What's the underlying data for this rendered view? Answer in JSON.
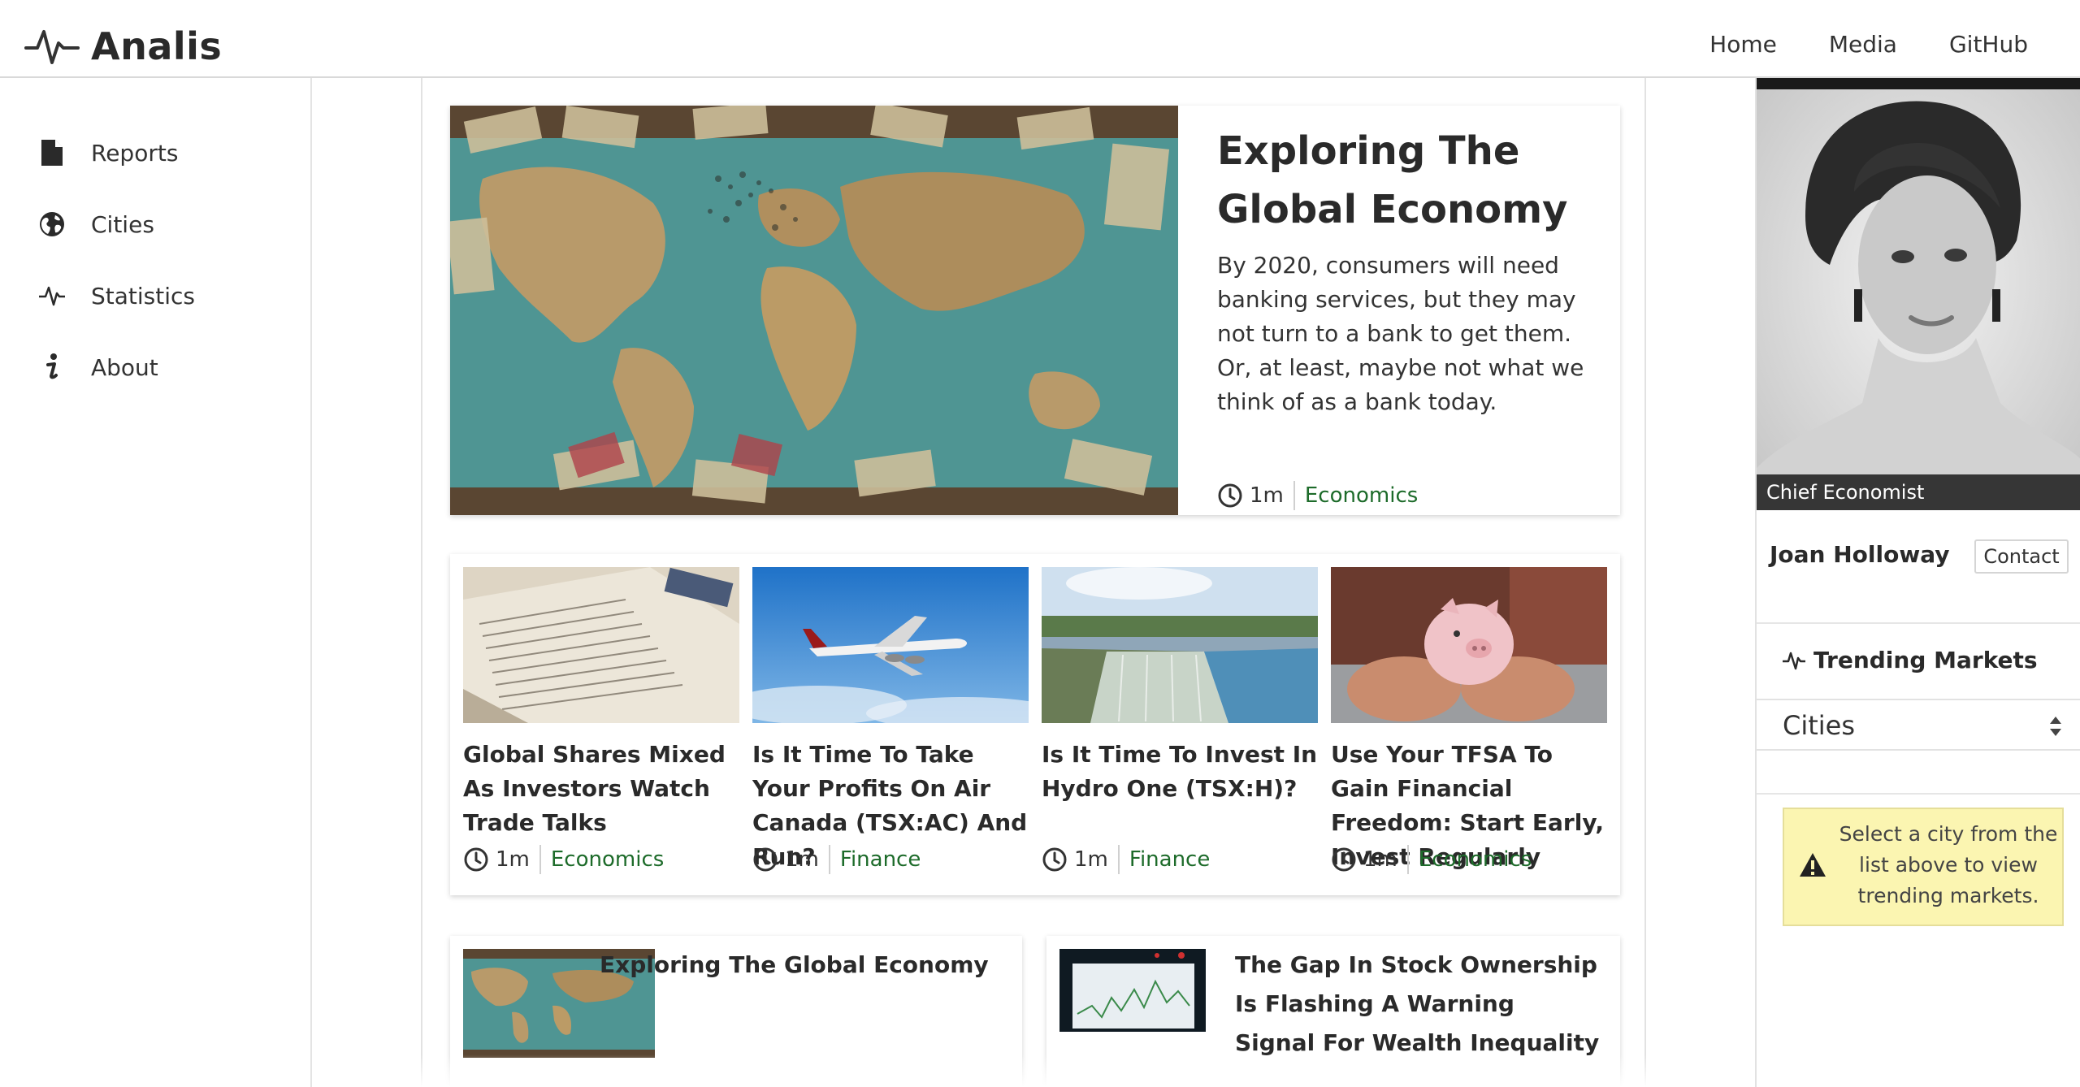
{
  "app": {
    "name": "Analis"
  },
  "topnav": {
    "items": [
      {
        "label": "Home"
      },
      {
        "label": "Media"
      },
      {
        "label": "GitHub"
      }
    ]
  },
  "sidebar": {
    "items": [
      {
        "label": "Reports",
        "icon": "document-icon"
      },
      {
        "label": "Cities",
        "icon": "globe-icon"
      },
      {
        "label": "Statistics",
        "icon": "pulse-icon"
      },
      {
        "label": "About",
        "icon": "info-icon"
      }
    ]
  },
  "hero": {
    "title": "Exploring The Global Economy",
    "description": "By 2020, consumers will need banking services, but they may not turn to a bank to get them. Or, at least, maybe not what we think of as a bank today.",
    "time": "1m",
    "category": "Economics"
  },
  "articles": [
    {
      "title": "Global Shares Mixed As Investors Watch Trade Talks",
      "time": "1m",
      "category": "Economics"
    },
    {
      "title": "Is It Time To Take Your Profits On Air Canada (TSX:AC) And Run?",
      "time": "1m",
      "category": "Finance"
    },
    {
      "title": "Is It Time To Invest In Hydro One (TSX:H)?",
      "time": "1m",
      "category": "Finance"
    },
    {
      "title": "Use Your TFSA To Gain Financial Freedom: Start Early, Invest Regularly",
      "time": "1m",
      "category": "Economics"
    }
  ],
  "bottom": [
    {
      "title": "Exploring The Global Economy"
    },
    {
      "title": "The Gap In Stock Ownership Is Flashing A Warning Signal For Wealth Inequality"
    }
  ],
  "profile": {
    "caption": "Chief Economist",
    "name": "Joan Holloway",
    "contact_label": "Contact"
  },
  "trending": {
    "title": "Trending Markets",
    "select_value": "Cities",
    "warning": "Select a city from the list above to view trending markets."
  },
  "colors": {
    "category_green": "#1d6b2a",
    "warning_bg": "#fbf5b1"
  }
}
